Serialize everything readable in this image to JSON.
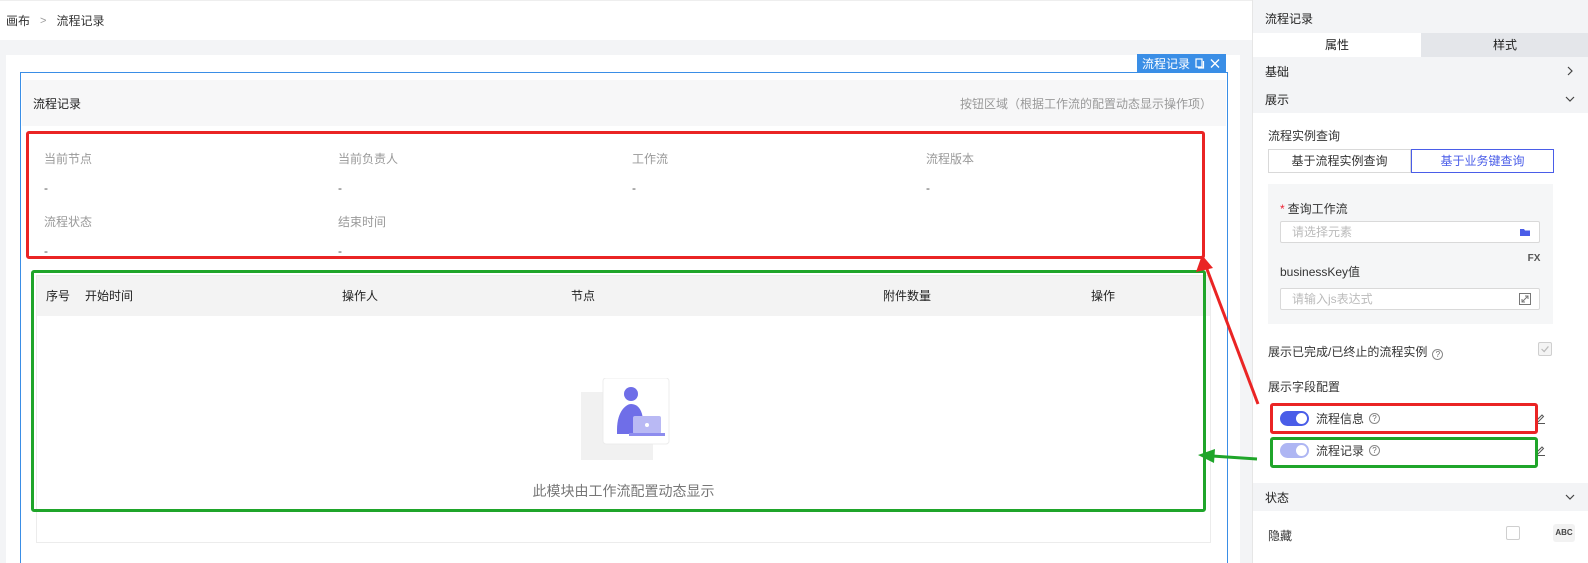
{
  "breadcrumb": {
    "root": "画布",
    "separator": ">",
    "current": "流程记录"
  },
  "selection_tag": {
    "label": "流程记录",
    "copy_icon": "copy-icon",
    "close_icon": "close-icon"
  },
  "card": {
    "title": "流程记录",
    "actions_hint": "按钮区域（根据工作流的配置动态显示操作项）",
    "info": [
      {
        "label": "当前节点",
        "value": "-"
      },
      {
        "label": "当前负责人",
        "value": "-"
      },
      {
        "label": "工作流",
        "value": "-"
      },
      {
        "label": "流程版本",
        "value": "-"
      },
      {
        "label": "流程状态",
        "value": "-"
      },
      {
        "label": "结束时间",
        "value": "-"
      }
    ],
    "table": {
      "columns": [
        "序号",
        "开始时间",
        "操作人",
        "节点",
        "附件数量",
        "操作"
      ],
      "empty_text": "此模块由工作流配置动态显示"
    }
  },
  "panel": {
    "title": "流程记录",
    "tabs": [
      "属性",
      "样式"
    ],
    "sections": {
      "basic": "基础",
      "display": "展示",
      "state": "状态"
    },
    "query_label": "流程实例查询",
    "query_modes": [
      "基于流程实例查询",
      "基于业务键查询"
    ],
    "workflow_label": "查询工作流",
    "workflow_placeholder": "请选择元素",
    "bizkey_label": "businessKey值",
    "fx_label": "FX",
    "bizkey_placeholder": "请输入js表达式",
    "show_completed_label": "展示已完成/已终止的流程实例",
    "field_config_label": "展示字段配置",
    "fields": [
      {
        "label": "流程信息",
        "enabled": true
      },
      {
        "label": "流程记录",
        "enabled": true
      }
    ],
    "hidden_label": "隐藏",
    "abc_label": "ABC"
  },
  "colors": {
    "accent": "#4a5de8",
    "selection": "#3a8ee6",
    "annotation_red": "#ea2424",
    "annotation_green": "#1fa52a"
  }
}
